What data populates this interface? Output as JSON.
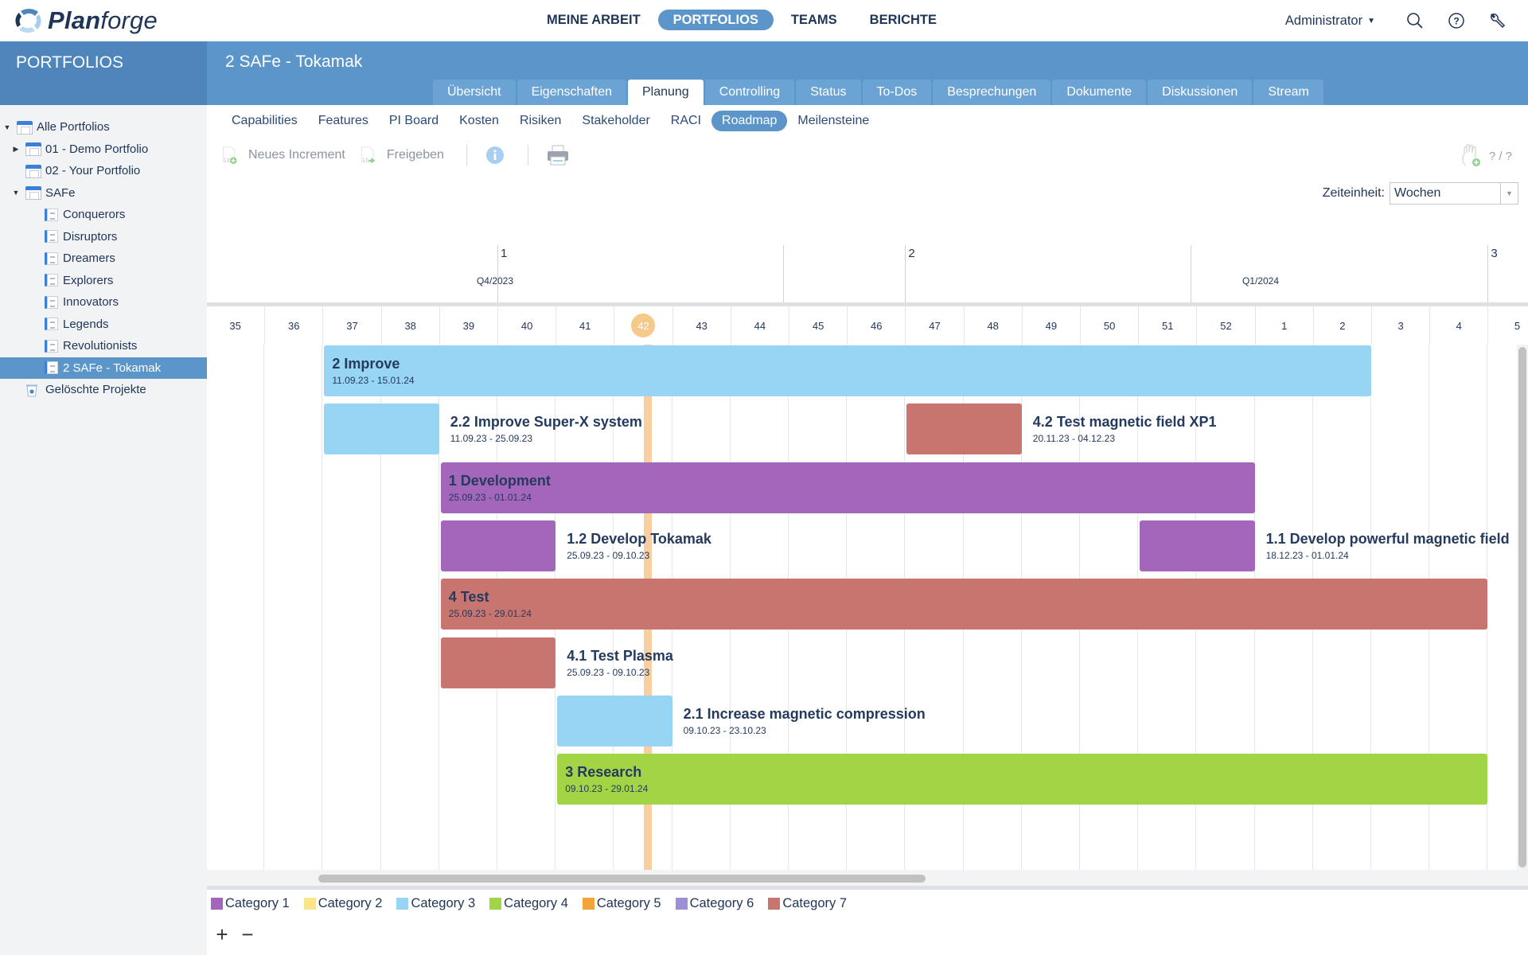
{
  "app": {
    "name_bold": "Plan",
    "name_light": "forge"
  },
  "main_nav": [
    {
      "label": "MEINE ARBEIT",
      "active": false
    },
    {
      "label": "PORTFOLIOS",
      "active": true
    },
    {
      "label": "TEAMS",
      "active": false
    },
    {
      "label": "BERICHTE",
      "active": false
    }
  ],
  "user": {
    "name": "Administrator",
    "icons": [
      "search-icon",
      "help-icon",
      "wrench-icon"
    ]
  },
  "sidebar": {
    "title": "PORTFOLIOS",
    "tree": [
      {
        "label": "Alle Portfolios",
        "level": 0,
        "toggle": "expanded",
        "icon": "portfolio",
        "selected": false
      },
      {
        "label": "01 - Demo Portfolio",
        "level": 1,
        "toggle": "collapsed",
        "icon": "portfolio",
        "selected": false
      },
      {
        "label": "02 - Your Portfolio",
        "level": 1,
        "toggle": "none",
        "icon": "portfolio",
        "selected": false
      },
      {
        "label": "SAFe",
        "level": 1,
        "toggle": "expanded",
        "icon": "portfolio",
        "selected": false
      },
      {
        "label": "Conquerors",
        "level": 2,
        "toggle": "none",
        "icon": "project",
        "selected": false
      },
      {
        "label": "Disruptors",
        "level": 2,
        "toggle": "none",
        "icon": "project",
        "selected": false
      },
      {
        "label": "Dreamers",
        "level": 2,
        "toggle": "none",
        "icon": "project",
        "selected": false
      },
      {
        "label": "Explorers",
        "level": 2,
        "toggle": "none",
        "icon": "project",
        "selected": false
      },
      {
        "label": "Innovators",
        "level": 2,
        "toggle": "none",
        "icon": "project",
        "selected": false
      },
      {
        "label": "Legends",
        "level": 2,
        "toggle": "none",
        "icon": "project",
        "selected": false
      },
      {
        "label": "Revolutionists",
        "level": 2,
        "toggle": "none",
        "icon": "project",
        "selected": false
      },
      {
        "label": "2 SAFe - Tokamak",
        "level": 2,
        "toggle": "none",
        "icon": "project",
        "selected": true
      },
      {
        "label": "Gelöschte Projekte",
        "level": 1,
        "toggle": "none",
        "icon": "trash",
        "selected": false
      }
    ]
  },
  "project": {
    "title": "2 SAFe - Tokamak"
  },
  "tabs": [
    {
      "label": "Übersicht",
      "active": false
    },
    {
      "label": "Eigenschaften",
      "active": false
    },
    {
      "label": "Planung",
      "active": true
    },
    {
      "label": "Controlling",
      "active": false
    },
    {
      "label": "Status",
      "active": false
    },
    {
      "label": "To-Dos",
      "active": false
    },
    {
      "label": "Besprechungen",
      "active": false
    },
    {
      "label": "Dokumente",
      "active": false
    },
    {
      "label": "Diskussionen",
      "active": false
    },
    {
      "label": "Stream",
      "active": false
    }
  ],
  "subnav": [
    {
      "label": "Capabilities",
      "active": false
    },
    {
      "label": "Features",
      "active": false
    },
    {
      "label": "PI Board",
      "active": false
    },
    {
      "label": "Kosten",
      "active": false
    },
    {
      "label": "Risiken",
      "active": false
    },
    {
      "label": "Stakeholder",
      "active": false
    },
    {
      "label": "RACI",
      "active": false
    },
    {
      "label": "Roadmap",
      "active": true
    },
    {
      "label": "Meilensteine",
      "active": false
    }
  ],
  "toolbar": {
    "new_increment": "Neues Increment",
    "release": "Freigeben",
    "assign_count": "? / ?"
  },
  "time_unit": {
    "label": "Zeiteinheit:",
    "value": "Wochen"
  },
  "timeline": {
    "increments": [
      {
        "label": "1",
        "start_week_index": 5
      },
      {
        "label": "2",
        "start_week_index": 12
      },
      {
        "label": "3",
        "start_week_index": 22
      }
    ],
    "quarters": [
      {
        "label": "Q4/2023",
        "start_week_index": 4.85
      },
      {
        "label": "Q1/2024",
        "start_week_index": 17
      }
    ],
    "weeks": [
      "35",
      "36",
      "37",
      "38",
      "39",
      "40",
      "41",
      "42",
      "43",
      "44",
      "45",
      "46",
      "47",
      "48",
      "49",
      "50",
      "51",
      "52",
      "1",
      "2",
      "3",
      "4",
      "5"
    ],
    "current_week_index": 7,
    "today_offset_weeks": 7.5
  },
  "colors": {
    "cat1": "#a366bb",
    "cat2": "#fce48a",
    "cat3": "#98d4f3",
    "cat4": "#a1d545",
    "cat5": "#f2a33a",
    "cat6": "#9f8ed6",
    "cat7": "#c87570",
    "accent": "#5b95c9"
  },
  "roadmap_items": [
    {
      "name": "2 Improve",
      "dates": "11.09.23 - 15.01.24",
      "start": 2,
      "end": 20,
      "category": "cat3",
      "label_inside": true
    },
    {
      "name": "2.2 Improve Super-X system",
      "dates": "11.09.23 - 25.09.23",
      "start": 2,
      "end": 4,
      "category": "cat3",
      "label_inside": false
    },
    {
      "name": "4.2 Test magnetic field XP1",
      "dates": "20.11.23 - 04.12.23",
      "start": 12,
      "end": 14,
      "category": "cat7",
      "label_inside": false,
      "row": 1
    },
    {
      "name": "1 Development",
      "dates": "25.09.23 - 01.01.24",
      "start": 4,
      "end": 18,
      "category": "cat1",
      "label_inside": true
    },
    {
      "name": "1.2 Develop Tokamak",
      "dates": "25.09.23 - 09.10.23",
      "start": 4,
      "end": 6,
      "category": "cat1",
      "label_inside": false
    },
    {
      "name": "1.1 Develop powerful magnetic field",
      "dates": "18.12.23 - 01.01.24",
      "start": 16,
      "end": 18,
      "category": "cat1",
      "label_inside": false,
      "row": 3
    },
    {
      "name": "4 Test",
      "dates": "25.09.23 - 29.01.24",
      "start": 4,
      "end": 22,
      "category": "cat7",
      "label_inside": true
    },
    {
      "name": "4.1 Test Plasma",
      "dates": "25.09.23 - 09.10.23",
      "start": 4,
      "end": 6,
      "category": "cat7",
      "label_inside": false
    },
    {
      "name": "2.1 Increase magnetic compression",
      "dates": "09.10.23 - 23.10.23",
      "start": 6,
      "end": 8,
      "category": "cat3",
      "label_inside": false
    },
    {
      "name": "3 Research",
      "dates": "09.10.23 - 29.01.24",
      "start": 6,
      "end": 22,
      "category": "cat4",
      "label_inside": true
    }
  ],
  "legend": [
    {
      "label": "Category 1",
      "color": "#a366bb"
    },
    {
      "label": "Category 2",
      "color": "#fce48a"
    },
    {
      "label": "Category 3",
      "color": "#98d4f3"
    },
    {
      "label": "Category 4",
      "color": "#a1d545"
    },
    {
      "label": "Category 5",
      "color": "#f2a33a"
    },
    {
      "label": "Category 6",
      "color": "#9f8ed6"
    },
    {
      "label": "Category 7",
      "color": "#c87570"
    }
  ],
  "zoom_controls": {
    "zoom_in": "+",
    "zoom_out": "−"
  }
}
